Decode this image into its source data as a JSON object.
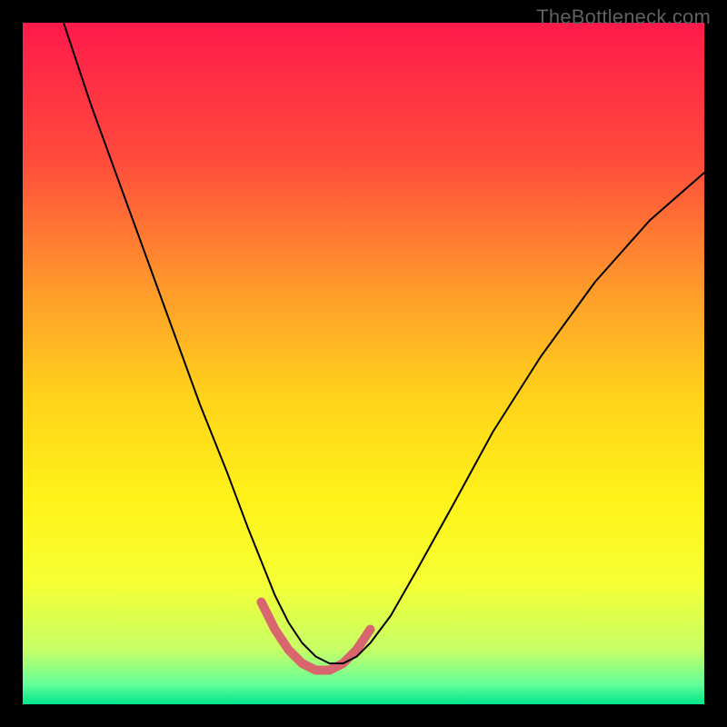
{
  "watermark": "TheBottleneck.com",
  "chart_data": {
    "type": "line",
    "title": "",
    "xlabel": "",
    "ylabel": "",
    "xlim": [
      0,
      100
    ],
    "ylim": [
      0,
      100
    ],
    "grid": false,
    "legend": false,
    "background_gradient": {
      "stops": [
        {
          "pos": 0.0,
          "color": "#ff1a4b"
        },
        {
          "pos": 0.2,
          "color": "#ff4b3c"
        },
        {
          "pos": 0.4,
          "color": "#ff9e2a"
        },
        {
          "pos": 0.55,
          "color": "#ffd31a"
        },
        {
          "pos": 0.7,
          "color": "#fff21a"
        },
        {
          "pos": 0.82,
          "color": "#f6ff33"
        },
        {
          "pos": 0.92,
          "color": "#c6ff66"
        },
        {
          "pos": 0.97,
          "color": "#66ff99"
        },
        {
          "pos": 1.0,
          "color": "#00e58a"
        }
      ]
    },
    "series": [
      {
        "name": "main-curve",
        "color": "#000000",
        "width": 2,
        "x": [
          6,
          10,
          14,
          18,
          22,
          26,
          30,
          33,
          35,
          37,
          39,
          41,
          43,
          45,
          47,
          49,
          51,
          54,
          58,
          63,
          69,
          76,
          84,
          92,
          100
        ],
        "y": [
          100,
          88,
          77,
          66,
          55,
          44,
          34,
          26,
          21,
          16,
          12,
          9,
          7,
          6,
          6,
          7,
          9,
          13,
          20,
          29,
          40,
          51,
          62,
          71,
          78
        ]
      },
      {
        "name": "bottom-highlight",
        "color": "#d9666f",
        "width": 10,
        "x": [
          35,
          37,
          39,
          41,
          43,
          45,
          47,
          49,
          51
        ],
        "y": [
          15,
          11,
          8,
          6,
          5,
          5,
          6,
          8,
          11
        ]
      }
    ],
    "annotations": []
  }
}
